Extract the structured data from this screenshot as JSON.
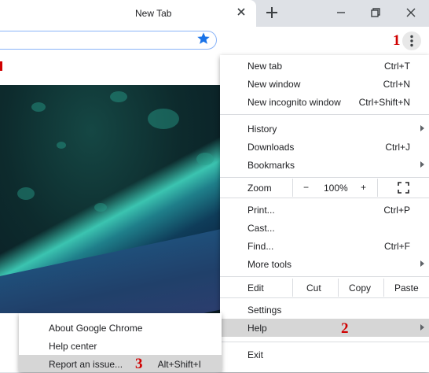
{
  "tab": {
    "title": "New Tab"
  },
  "markers": {
    "m1": "1",
    "m2": "2",
    "m3": "3"
  },
  "menu": {
    "new_tab": {
      "label": "New tab",
      "shortcut": "Ctrl+T"
    },
    "new_window": {
      "label": "New window",
      "shortcut": "Ctrl+N"
    },
    "incognito": {
      "label": "New incognito window",
      "shortcut": "Ctrl+Shift+N"
    },
    "history": {
      "label": "History"
    },
    "downloads": {
      "label": "Downloads",
      "shortcut": "Ctrl+J"
    },
    "bookmarks": {
      "label": "Bookmarks"
    },
    "zoom": {
      "label": "Zoom",
      "minus": "−",
      "value": "100%",
      "plus": "+"
    },
    "print": {
      "label": "Print...",
      "shortcut": "Ctrl+P"
    },
    "cast": {
      "label": "Cast..."
    },
    "find": {
      "label": "Find...",
      "shortcut": "Ctrl+F"
    },
    "more_tools": {
      "label": "More tools"
    },
    "edit": {
      "label": "Edit",
      "cut": "Cut",
      "copy": "Copy",
      "paste": "Paste"
    },
    "settings": {
      "label": "Settings"
    },
    "help": {
      "label": "Help"
    },
    "exit": {
      "label": "Exit"
    }
  },
  "help_submenu": {
    "about": {
      "label": "About Google Chrome"
    },
    "help_center": {
      "label": "Help center"
    },
    "report": {
      "label": "Report an issue...",
      "shortcut": "Alt+Shift+I"
    }
  },
  "colors": {
    "accent": "#1a73e8",
    "marker": "#d00000",
    "highlight": "#d6d6d6"
  }
}
